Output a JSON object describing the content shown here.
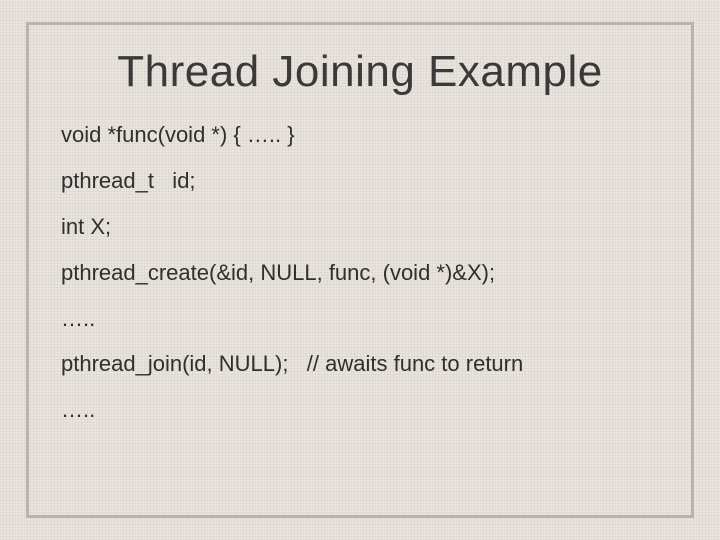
{
  "slide": {
    "title": "Thread Joining Example",
    "lines": [
      "void *func(void *) { ….. }",
      "pthread_t   id;",
      "int X;",
      "pthread_create(&id, NULL, func, (void *)&X);",
      "…..",
      "pthread_join(id, NULL);   // awaits func to return",
      "….."
    ]
  }
}
